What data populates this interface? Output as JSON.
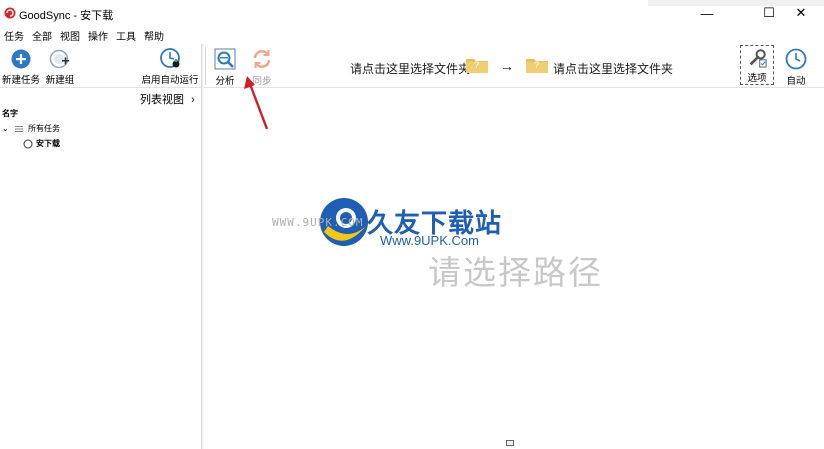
{
  "window": {
    "title": "GoodSync - 安下载",
    "minimize": "—",
    "maximize": "☐",
    "close": "✕"
  },
  "menu": [
    "任务",
    "全部",
    "视图",
    "操作",
    "工具",
    "帮助"
  ],
  "toolbar": {
    "new_job": "新建任务",
    "new_group": "新建组",
    "auto_run": "启用自动运行",
    "analyze": "分析",
    "sync": "同步",
    "options": "选项",
    "auto": "自动",
    "left_path": "请点击这里选择文件夹",
    "right_path": "请点击这里选择文件夹",
    "folder_mark": "?",
    "arrow": "→"
  },
  "left_pane": {
    "view_toggle": "列表视图",
    "view_toggle_chevron": "›",
    "name_header": "名字",
    "tree": {
      "all_jobs": "所有任务",
      "job": "安下载",
      "expand_chevron": "⌄"
    }
  },
  "right_pane": {
    "hint": "请选择路径"
  },
  "watermark": {
    "brand": "久友下载站",
    "url": "Www.9UPK.Com",
    "left_text": "WWW.9UPK.COM"
  },
  "colors": {
    "accent_blue": "#2b78c5",
    "sync_orange": "#f0a58a",
    "folder_yellow": "#e8c060",
    "arrow_red": "#d21f26"
  }
}
